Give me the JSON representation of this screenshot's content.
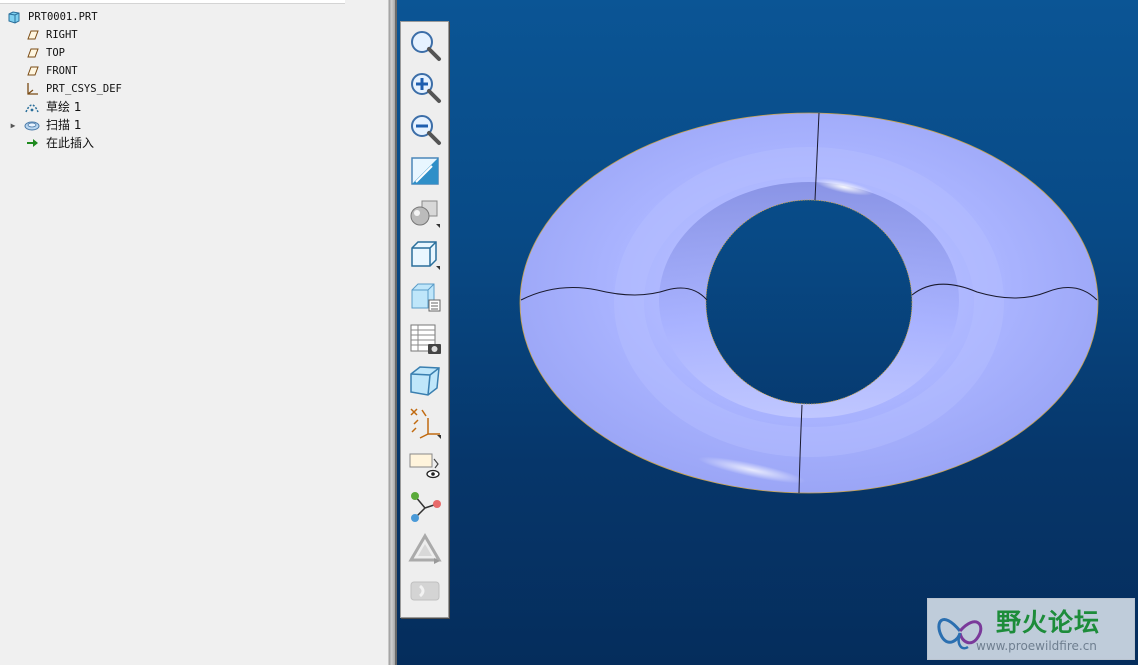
{
  "model_tree": {
    "items": [
      {
        "label": "PRT0001.PRT",
        "icon": "part-icon",
        "indent": 0,
        "expandable": false
      },
      {
        "label": "RIGHT",
        "icon": "datum-plane-icon",
        "indent": 1,
        "expandable": false
      },
      {
        "label": "TOP",
        "icon": "datum-plane-icon",
        "indent": 1,
        "expandable": false
      },
      {
        "label": "FRONT",
        "icon": "datum-plane-icon",
        "indent": 1,
        "expandable": false
      },
      {
        "label": "PRT_CSYS_DEF",
        "icon": "csys-icon",
        "indent": 1,
        "expandable": false
      },
      {
        "label": "草绘 1",
        "icon": "sketch-icon",
        "indent": 1,
        "expandable": false
      },
      {
        "label": "扫描 1",
        "icon": "sweep-icon",
        "indent": 1,
        "expandable": true
      },
      {
        "label": "在此插入",
        "icon": "insert-here-arrow-icon",
        "indent": 1,
        "expandable": false
      }
    ]
  },
  "view_toolbar": {
    "buttons": [
      {
        "name": "refit-button",
        "icon": "refit-magnifier-icon"
      },
      {
        "name": "zoom-in-button",
        "icon": "zoom-in-icon"
      },
      {
        "name": "zoom-out-button",
        "icon": "zoom-out-icon"
      },
      {
        "name": "repaint-button",
        "icon": "repaint-icon"
      },
      {
        "name": "display-style-button",
        "icon": "shading-style-icon"
      },
      {
        "name": "saved-orientations-button",
        "icon": "saved-orientation-cube-icon"
      },
      {
        "name": "view-manager-button",
        "icon": "view-manager-icon"
      },
      {
        "name": "layers-button",
        "icon": "layer-table-camera-icon"
      },
      {
        "name": "perspective-view-button",
        "icon": "perspective-cube-icon"
      },
      {
        "name": "datum-display-button",
        "icon": "datum-display-filter-icon"
      },
      {
        "name": "annotation-display-button",
        "icon": "annotation-eye-icon"
      },
      {
        "name": "spin-center-button",
        "icon": "spin-center-icon"
      },
      {
        "name": "appearance-button",
        "icon": "appearance-triangle-icon"
      },
      {
        "name": "disabled-button",
        "icon": "disabled-tool-icon"
      }
    ]
  },
  "colors": {
    "torus_fill": "#aab4ff",
    "torus_shadow": "#8b96e8",
    "background_top": "#0b5595",
    "background_bottom": "#052d5c",
    "watermark_green": "#1d8c3a"
  },
  "watermark": {
    "title": "野火论坛",
    "url": "www.proewildfire.cn"
  }
}
